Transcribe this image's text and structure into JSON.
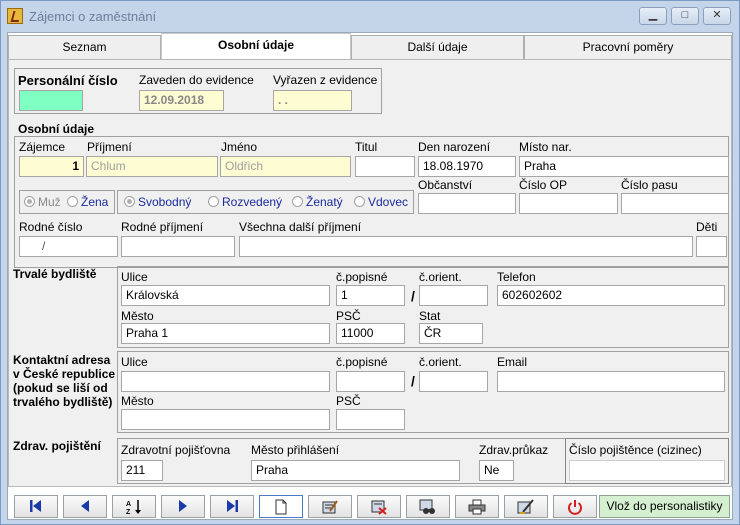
{
  "window": {
    "title": "Zájemci o zaměstnání",
    "minimize": "▁",
    "maximize": "□",
    "close": "✕"
  },
  "tabs": [
    "Seznam",
    "Osobní údaje",
    "Další údaje",
    "Pracovní poměry"
  ],
  "header": {
    "personal_number_label": "Personální číslo",
    "personal_number_value": "",
    "registered_label": "Zaveden do evidence",
    "registered_value": "12.09.2018",
    "removed_label": "Vyřazen z evidence",
    "removed_value": ". ."
  },
  "personal": {
    "section_label": "Osobní údaje",
    "applicant_label": "Zájemce",
    "applicant_value": "1",
    "surname_label": "Příjmení",
    "surname_value": "Chlum",
    "firstname_label": "Jméno",
    "firstname_value": "Oldřich",
    "title_label": "Titul",
    "title_value": "",
    "birthdate_label": "Den narození",
    "birthdate_value": "18.08.1970",
    "birthplace_label": "Místo nar.",
    "birthplace_value": "Praha",
    "gender_male": "Muž",
    "gender_female": "Žena",
    "status_single": "Svobodný",
    "status_divorced": "Rozvedený",
    "status_married": "Ženatý",
    "status_widowed": "Vdovec",
    "citizenship_label": "Občanství",
    "citizenship_value": "",
    "op_label": "Číslo OP",
    "op_value": "",
    "passport_label": "Číslo pasu",
    "passport_value": "",
    "birth_number_label": "Rodné číslo",
    "birth_number_value": "/",
    "birth_surname_label": "Rodné příjmení",
    "birth_surname_value": "",
    "other_surnames_label": "Všechna další příjmení",
    "other_surnames_value": "",
    "children_label": "Děti",
    "children_value": ""
  },
  "permanent": {
    "section_label": "Trvalé bydliště",
    "street_label": "Ulice",
    "street_value": "Královská",
    "cp_label": "č.popisné",
    "cp_value": "1",
    "co_label": "č.orient.",
    "co_value": "",
    "phone_label": "Telefon",
    "phone_value": "602602602",
    "city_label": "Město",
    "city_value": "Praha 1",
    "psc_label": "PSČ",
    "psc_value": "11000",
    "state_label": "Stat",
    "state_value": "ČR",
    "slash": "/"
  },
  "contact": {
    "section_label_1": "Kontaktní adresa",
    "section_label_2": "v České republice",
    "section_label_3": "(pokud se liší od",
    "section_label_4": "trvalého bydliště)",
    "street_label": "Ulice",
    "street_value": "",
    "cp_label": "č.popisné",
    "cp_value": "",
    "co_label": "č.orient.",
    "co_value": "",
    "email_label": "Email",
    "email_value": "",
    "city_label": "Město",
    "city_value": "",
    "psc_label": "PSČ",
    "psc_value": "",
    "slash": "/"
  },
  "insurance": {
    "section_label": "Zdrav. pojištění",
    "insurer_label": "Zdravotní pojišťovna",
    "insurer_value": "211",
    "city_label": "Město přihlášení",
    "city_value": "Praha",
    "card_label": "Zdrav.průkaz",
    "card_value": "Ne",
    "foreign_label": "Číslo pojištěnce (cizinec)",
    "foreign_value": ""
  },
  "toolbar": {
    "vloz_label": "Vlož do personalistiky",
    "icons": [
      "first-icon",
      "prev-icon",
      "sort-icon",
      "next-icon",
      "last-icon",
      "new-icon",
      "edit-icon",
      "delete-icon",
      "find-icon",
      "print-icon",
      "tools-icon",
      "power-icon"
    ]
  },
  "colors": {
    "window_bg": "#c4d5ea",
    "panel_bg": "#f0f0f0",
    "readonly_yellow": "#fdfcd2",
    "personal_number_green": "#7fffc2",
    "radio_blue": "#1a2a9a",
    "vloz_green": "#d5f0d0",
    "nav_blue": "#1a3aa8",
    "power_red": "#d42020"
  }
}
